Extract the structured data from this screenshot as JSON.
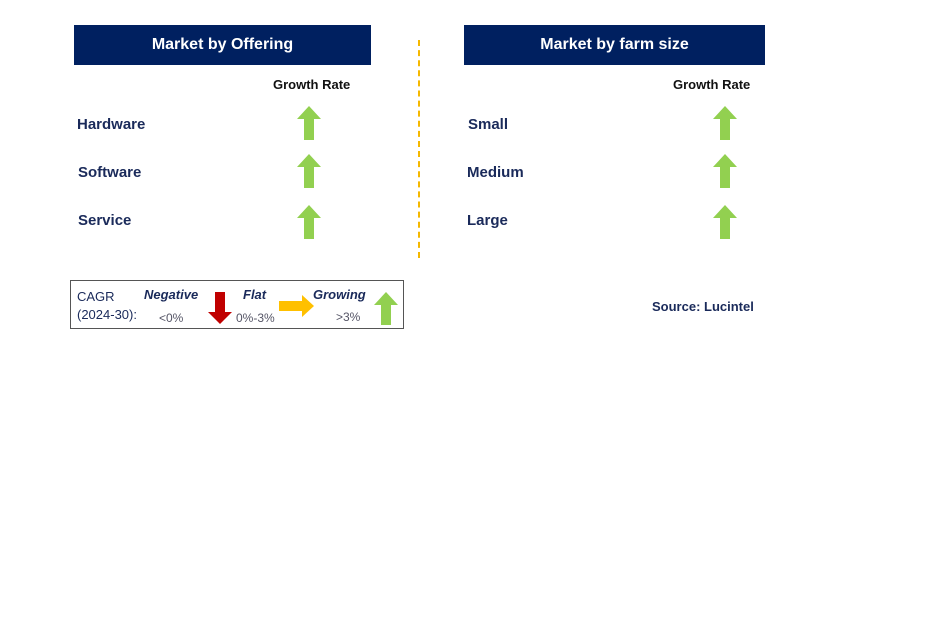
{
  "left_panel": {
    "title": "Market by Offering",
    "column_header": "Growth Rate",
    "rows": [
      {
        "label": "Hardware",
        "trend": "growing"
      },
      {
        "label": "Software",
        "trend": "growing"
      },
      {
        "label": "Service",
        "trend": "growing"
      }
    ]
  },
  "right_panel": {
    "title": "Market by farm size",
    "column_header": "Growth Rate",
    "rows": [
      {
        "label": "Small",
        "trend": "growing"
      },
      {
        "label": "Medium",
        "trend": "growing"
      },
      {
        "label": "Large",
        "trend": "growing"
      }
    ]
  },
  "legend": {
    "cagr": "CAGR",
    "period": "(2024-30):",
    "negative": {
      "label": "Negative",
      "range": "<0%",
      "icon": "arrow-down-icon",
      "color": "#C00000"
    },
    "flat": {
      "label": "Flat",
      "range": "0%-3%",
      "icon": "arrow-right-icon",
      "color": "#FFC000"
    },
    "growing": {
      "label": "Growing",
      "range": ">3%",
      "icon": "arrow-up-icon",
      "color": "#92D050"
    }
  },
  "source": "Source: Lucintel",
  "colors": {
    "header": "#002060",
    "growing": "#92D050",
    "divider": "#F5B800"
  }
}
